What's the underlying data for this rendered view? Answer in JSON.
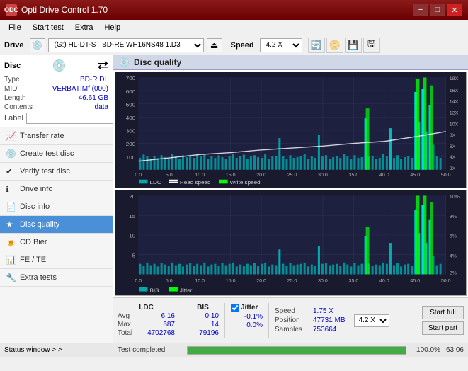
{
  "app": {
    "title": "Opti Drive Control 1.70",
    "icon": "ODC"
  },
  "titlebar": {
    "buttons": {
      "minimize": "−",
      "maximize": "□",
      "close": "✕"
    }
  },
  "menu": {
    "items": [
      "File",
      "Start test",
      "Extra",
      "Help"
    ]
  },
  "drive_bar": {
    "label": "Drive",
    "drive_value": "(G:)  HL-DT-ST BD-RE  WH16NS48 1.D3",
    "speed_label": "Speed",
    "speed_value": "4.2 X"
  },
  "disc_panel": {
    "title": "Disc",
    "type_label": "Type",
    "type_value": "BD-R DL",
    "mid_label": "MID",
    "mid_value": "VERBATIMf (000)",
    "length_label": "Length",
    "length_value": "46.61 GB",
    "contents_label": "Contents",
    "contents_value": "data",
    "label_label": "Label",
    "label_value": ""
  },
  "sidebar": {
    "items": [
      {
        "id": "transfer-rate",
        "label": "Transfer rate",
        "icon": "📈"
      },
      {
        "id": "create-test-disc",
        "label": "Create test disc",
        "icon": "💿"
      },
      {
        "id": "verify-test-disc",
        "label": "Verify test disc",
        "icon": "✔"
      },
      {
        "id": "drive-info",
        "label": "Drive info",
        "icon": "ℹ"
      },
      {
        "id": "disc-info",
        "label": "Disc info",
        "icon": "📄"
      },
      {
        "id": "disc-quality",
        "label": "Disc quality",
        "icon": "★",
        "active": true
      },
      {
        "id": "cd-bier",
        "label": "CD Bier",
        "icon": "🍺"
      },
      {
        "id": "fe-te",
        "label": "FE / TE",
        "icon": "📊"
      },
      {
        "id": "extra-tests",
        "label": "Extra tests",
        "icon": "🔧"
      }
    ]
  },
  "status_window": {
    "label": "Status window > >"
  },
  "disc_quality": {
    "title": "Disc quality",
    "chart1": {
      "legend": {
        "ldc": "LDC",
        "read_speed": "Read speed",
        "write_speed": "Write speed"
      },
      "y_max": 700,
      "y_right_max": 18,
      "y_right_label": "X",
      "x_max": 50,
      "y_ticks": [
        "700",
        "600",
        "500",
        "400",
        "300",
        "200",
        "100"
      ],
      "x_ticks": [
        "0.0",
        "5.0",
        "10.0",
        "15.0",
        "20.0",
        "25.0",
        "30.0",
        "35.0",
        "40.0",
        "45.0",
        "50.0"
      ],
      "y_right_ticks": [
        "18X",
        "16X",
        "14X",
        "12X",
        "10X",
        "8X",
        "6X",
        "4X",
        "2X"
      ]
    },
    "chart2": {
      "legend": {
        "bis": "BIS",
        "jitter": "Jitter"
      },
      "y_max": 20,
      "y_right_max": 10,
      "y_right_label": "%",
      "x_max": 50,
      "y_ticks": [
        "20",
        "15",
        "10",
        "5"
      ],
      "x_ticks": [
        "0.0",
        "5.0",
        "10.0",
        "15.0",
        "20.0",
        "25.0",
        "30.0",
        "35.0",
        "40.0",
        "45.0",
        "50.0"
      ],
      "y_right_ticks": [
        "10%",
        "8%",
        "6%",
        "4%",
        "2%"
      ]
    }
  },
  "stats": {
    "columns": {
      "ldc_header": "LDC",
      "bis_header": "BIS",
      "jitter_header": "Jitter"
    },
    "avg_label": "Avg",
    "max_label": "Max",
    "total_label": "Total",
    "ldc_avg": "6.16",
    "ldc_max": "687",
    "ldc_total": "4702768",
    "bis_avg": "0.10",
    "bis_max": "14",
    "bis_total": "79196",
    "jitter_avg": "-0.1%",
    "jitter_max": "0.0%",
    "jitter_label": "Jitter",
    "speed_label": "Speed",
    "speed_value": "1.75 X",
    "position_label": "Position",
    "position_value": "47731 MB",
    "samples_label": "Samples",
    "samples_value": "753664",
    "speed_select_value": "4.2 X",
    "start_full_label": "Start full",
    "start_part_label": "Start part"
  },
  "progress": {
    "label": "Test completed",
    "percent": "100.0%",
    "fill_percent": 100,
    "count": "63:06"
  }
}
